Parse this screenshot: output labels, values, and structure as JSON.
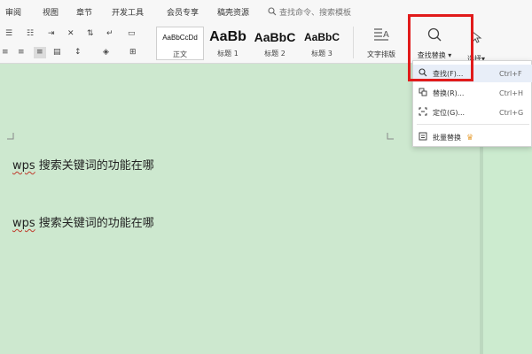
{
  "tabs": [
    "审阅",
    "视图",
    "章节",
    "开发工具",
    "会员专享",
    "稿壳资源"
  ],
  "search": {
    "placeholder": "查找命令、搜索模板",
    "icon": "search-icon"
  },
  "styles": [
    {
      "preview": "AaBbCcDd",
      "label": "正文"
    },
    {
      "preview": "AaBb",
      "label": "标题 1"
    },
    {
      "preview": "AaBbC",
      "label": "标题 2"
    },
    {
      "preview": "AaBbC",
      "label": "标题 3"
    }
  ],
  "text_layout": {
    "label": "文字排版",
    "icon": "text-layout-icon"
  },
  "find_replace": {
    "label": "查找替换",
    "icon": "search-icon"
  },
  "select": {
    "label": "选择",
    "icon": "cursor-icon"
  },
  "dropdown": {
    "items": [
      {
        "label": "查找(F)...",
        "shortcut": "Ctrl+F",
        "icon": "search-icon"
      },
      {
        "label": "替换(R)...",
        "shortcut": "Ctrl+H",
        "icon": "replace-icon"
      },
      {
        "label": "定位(G)...",
        "shortcut": "Ctrl+G",
        "icon": "goto-icon"
      },
      {
        "label": "批量替换",
        "icon": "batch-replace-icon",
        "badge": "crown-icon"
      }
    ]
  },
  "document": {
    "lines": [
      {
        "prefix": "wps",
        "text": " 搜索关键词的功能在哪"
      },
      {
        "prefix": "wps",
        "text": " 搜索关键词的功能在哪"
      }
    ]
  },
  "colors": {
    "page": "#cde8cf",
    "highlight": "#e11b1b",
    "ribbon": "#f7f7f7"
  }
}
